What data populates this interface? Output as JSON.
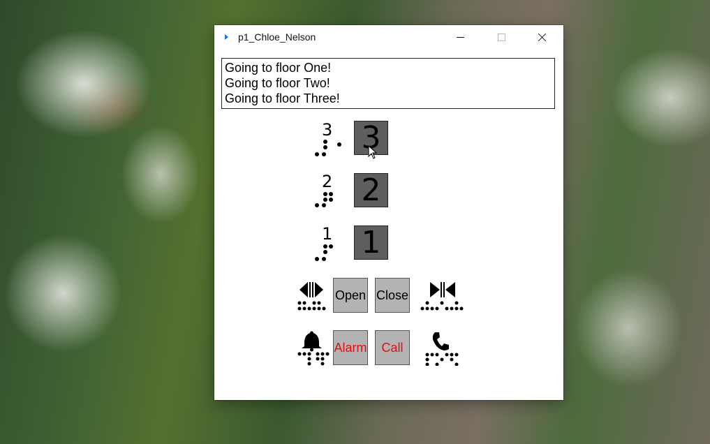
{
  "window": {
    "title": "p1_Chloe_Nelson"
  },
  "log": {
    "lines": [
      "Going to floor One!",
      "Going to floor Two!",
      "Going to floor Three!"
    ]
  },
  "floors": [
    {
      "label": "3",
      "button": "3"
    },
    {
      "label": "2",
      "button": "2"
    },
    {
      "label": "1",
      "button": "1"
    }
  ],
  "controls": {
    "open": "Open",
    "close": "Close",
    "alarm": "Alarm",
    "call": "Call"
  },
  "colors": {
    "floor_button": "#5e5e5e",
    "control_button": "#b3b3b3",
    "emergency_text": "#e01010"
  },
  "icons": {
    "open_doors": "door-open-icon",
    "close_doors": "door-close-icon",
    "alarm": "bell-icon",
    "call": "phone-icon"
  }
}
